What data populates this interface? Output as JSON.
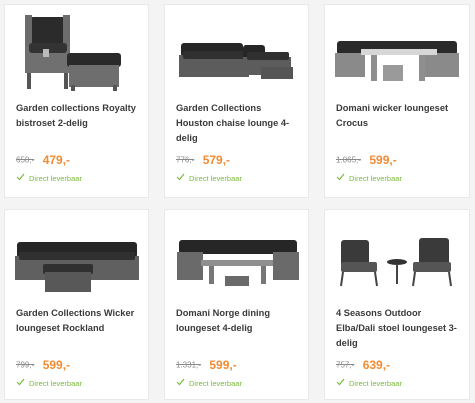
{
  "colors": {
    "accent_price": "#f28b33",
    "stock_green": "#7ab93e"
  },
  "products": [
    {
      "name": "Garden collections Royalty bistroset 2-delig",
      "old_price": "650,-",
      "price": "479,-",
      "availability": "Direct leverbaar",
      "image_icon": "wicker-recliner-chair-with-footstool"
    },
    {
      "name": "Garden Collections Houston chaise lounge 4-delig",
      "old_price": "776,-",
      "price": "579,-",
      "availability": "Direct leverbaar",
      "image_icon": "wicker-chaise-lounge-set"
    },
    {
      "name": "Domani wicker loungeset Crocus",
      "old_price": "1.065,-",
      "price": "599,-",
      "availability": "Direct leverbaar",
      "image_icon": "wicker-corner-dining-set"
    },
    {
      "name": "Garden Collections Wicker loungeset Rockland",
      "old_price": "799,-",
      "price": "599,-",
      "availability": "Direct leverbaar",
      "image_icon": "wicker-corner-lounge-set"
    },
    {
      "name": "Domani Norge dining loungeset 4-delig",
      "old_price": "1.331,-",
      "price": "599,-",
      "availability": "Direct leverbaar",
      "image_icon": "wicker-dining-lounge-set"
    },
    {
      "name": "4 Seasons Outdoor Elba/Dali stoel loungeset 3-delig",
      "old_price": "757,-",
      "price": "639,-",
      "availability": "Direct leverbaar",
      "image_icon": "metal-lounge-chairs-with-table"
    }
  ]
}
